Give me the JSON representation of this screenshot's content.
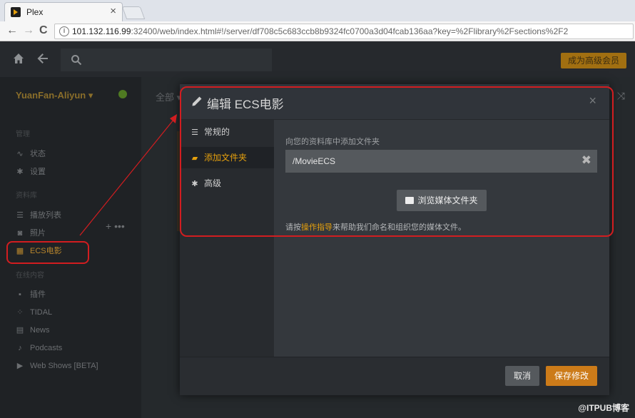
{
  "browser": {
    "tab_title": "Plex",
    "tab_close": "×",
    "url_host": "101.132.116.99",
    "url_rest": ":32400/web/index.html#!/server/df708c5c683ccb8b9324fc0700a3d04fcab136aa?key=%2Flibrary%2Fsections%2F2",
    "back": "←",
    "forward": "→",
    "reload": "C"
  },
  "topbar": {
    "premium_label": "成为高级会员"
  },
  "sidebar": {
    "server_name": "YuanFan-Aliyun ▾",
    "section_manage": "管理",
    "section_libraries": "资料库",
    "section_online": "在线内容",
    "items": [
      {
        "label": "状态",
        "icon": "activity-icon",
        "glyph": "∿"
      },
      {
        "label": "设置",
        "icon": "gear-icon",
        "glyph": "✱"
      },
      {
        "label": "播放列表",
        "icon": "list-icon",
        "glyph": "☰"
      },
      {
        "label": "照片",
        "icon": "camera-icon",
        "glyph": "◙"
      },
      {
        "label": "ECS电影",
        "icon": "film-icon",
        "glyph": "▦"
      },
      {
        "label": "插件",
        "icon": "grid-icon",
        "glyph": "▪"
      },
      {
        "label": "TIDAL",
        "icon": "tidal-icon",
        "glyph": "⁘"
      },
      {
        "label": "News",
        "icon": "news-icon",
        "glyph": "▤"
      },
      {
        "label": "Podcasts",
        "icon": "mic-icon",
        "glyph": "♪"
      },
      {
        "label": "Web Shows [BETA]",
        "icon": "play-icon",
        "glyph": "▶"
      }
    ],
    "lib_tools": "+ •••"
  },
  "main": {
    "tab_all": "全部 ▾",
    "shuffle": "⤨"
  },
  "modal": {
    "title": "编辑 ECS电影",
    "close": "×",
    "nav": [
      {
        "label": "常规的",
        "glyph": "☰"
      },
      {
        "label": "添加文件夹",
        "glyph": "▰"
      },
      {
        "label": "高级",
        "glyph": "✱"
      }
    ],
    "add_folder_label": "向您的资料库中添加文件夹",
    "folder_value": "/MovieECS",
    "remove_glyph": "✖",
    "browse_label": "浏览媒体文件夹",
    "help_prefix": "请按",
    "help_link": "操作指导",
    "help_suffix": "来帮助我们命名和组织您的媒体文件。",
    "cancel_label": "取消",
    "save_label": "保存修改"
  },
  "watermark": "@ITPUB博客",
  "colors": {
    "accent": "#e5a00d",
    "annotation": "#d21d20",
    "save": "#cc7b19"
  }
}
